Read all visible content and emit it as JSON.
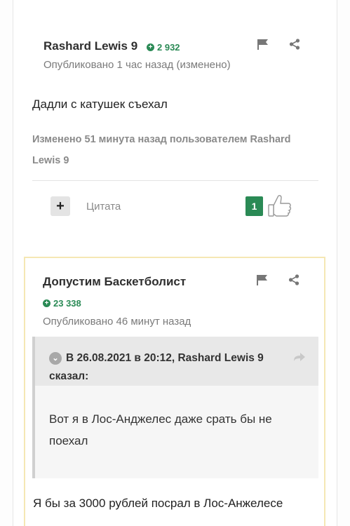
{
  "post1": {
    "author": "Rashard Lewis 9",
    "reputation": "2 932",
    "meta": "Опубликовано 1 час назад (изменено)",
    "body": "Дадли с катушек съехал",
    "edited_note": "Изменено 51 минута назад пользователем Rashard Lewis 9",
    "quote_label": "Цитата",
    "likes": "1"
  },
  "post2": {
    "author": "Допустим Баскетболист",
    "reputation": "23 338",
    "meta": "Опубликовано 46 минут назад",
    "quote_header": "В 26.08.2021 в 20:12, Rashard Lewis 9 сказал:",
    "quote_body": "Вот я в Лос-Анджелес даже срать бы не поехал",
    "body": "Я бы за 3000 рублей посрал в Лос-Анжелесе"
  },
  "colors": {
    "accent_green": "#2a8a55",
    "highlight_border": "#f5e7b4"
  },
  "icons": [
    "flag-icon",
    "share-icon",
    "plus-icon",
    "thumbs-up-icon",
    "chevron-down-icon",
    "reply-arrow-icon"
  ]
}
